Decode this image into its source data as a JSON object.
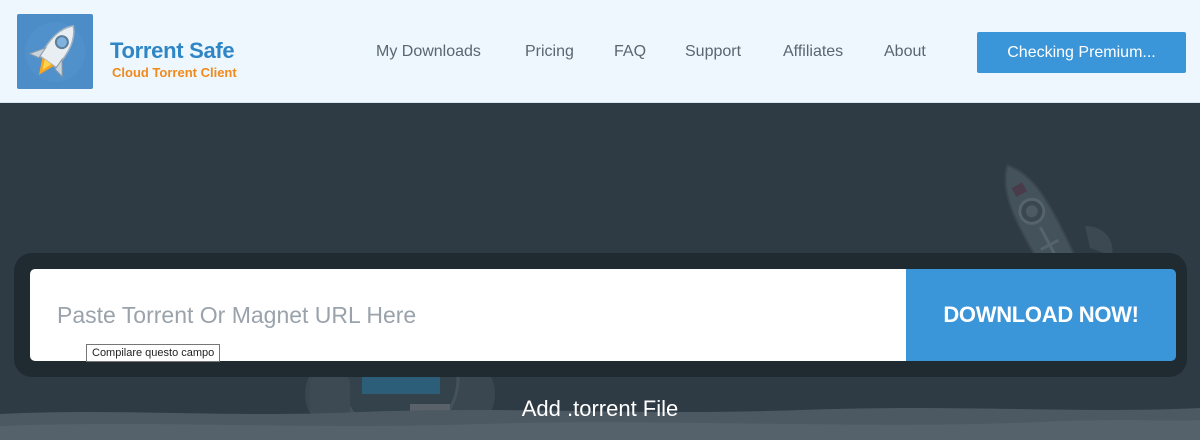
{
  "brand": {
    "title": "Torrent Safe",
    "subtitle": "Cloud Torrent Client",
    "logo_icon": "rocket-icon"
  },
  "nav": {
    "items": [
      {
        "label": "My Downloads"
      },
      {
        "label": "Pricing"
      },
      {
        "label": "FAQ"
      },
      {
        "label": "Support"
      },
      {
        "label": "Affiliates"
      },
      {
        "label": "About"
      }
    ],
    "premium_button": "Checking Premium..."
  },
  "hero": {
    "url_input_placeholder": "Paste Torrent Or Magnet URL Here",
    "download_button": "DOWNLOAD NOW!",
    "tooltip": "Compilare questo campo",
    "add_torrent": "Add .torrent File",
    "illustrations": [
      "rocket-illustration",
      "astronaut-illustration"
    ]
  },
  "colors": {
    "accent": "#3a95d9",
    "brand_blue": "#2f86c6",
    "brand_orange": "#f08a1c",
    "hero_bg": "#2e3b44",
    "header_bg": "#eef7fd"
  }
}
